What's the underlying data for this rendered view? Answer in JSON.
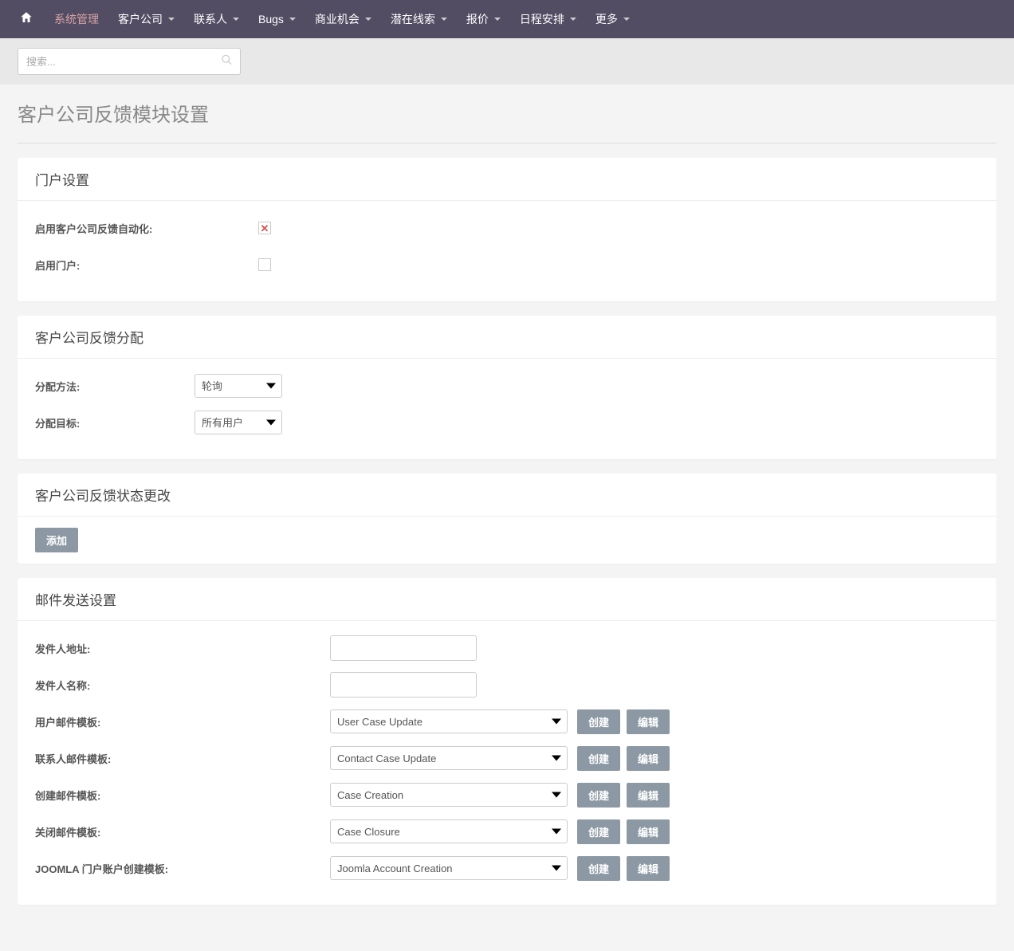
{
  "nav": {
    "items": [
      {
        "label": "系统管理",
        "active": true,
        "hasDropdown": false
      },
      {
        "label": "客户公司",
        "active": false,
        "hasDropdown": true
      },
      {
        "label": "联系人",
        "active": false,
        "hasDropdown": true
      },
      {
        "label": "Bugs",
        "active": false,
        "hasDropdown": true
      },
      {
        "label": "商业机会",
        "active": false,
        "hasDropdown": true
      },
      {
        "label": "潜在线索",
        "active": false,
        "hasDropdown": true
      },
      {
        "label": "报价",
        "active": false,
        "hasDropdown": true
      },
      {
        "label": "日程安排",
        "active": false,
        "hasDropdown": true
      },
      {
        "label": "更多",
        "active": false,
        "hasDropdown": true
      }
    ]
  },
  "search": {
    "placeholder": "搜索..."
  },
  "page": {
    "title": "客户公司反馈模块设置"
  },
  "sections": {
    "portal": {
      "title": "门户设置",
      "fields": {
        "enableAuto": {
          "label": "启用客户公司反馈自动化:",
          "checked": false,
          "x": true
        },
        "enablePortal": {
          "label": "启用门户:",
          "checked": false,
          "x": false
        }
      }
    },
    "assignment": {
      "title": "客户公司反馈分配",
      "fields": {
        "method": {
          "label": "分配方法:",
          "value": "轮询"
        },
        "target": {
          "label": "分配目标:",
          "value": "所有用户"
        }
      }
    },
    "stateChange": {
      "title": "客户公司反馈状态更改",
      "addButton": "添加"
    },
    "email": {
      "title": "邮件发送设置",
      "fields": {
        "fromAddr": {
          "label": "发件人地址:",
          "value": ""
        },
        "fromName": {
          "label": "发件人名称:",
          "value": ""
        }
      },
      "templates": [
        {
          "label": "用户邮件模板:",
          "value": "User Case Update"
        },
        {
          "label": "联系人邮件模板:",
          "value": "Contact Case Update"
        },
        {
          "label": "创建邮件模板:",
          "value": "Case Creation"
        },
        {
          "label": "关闭邮件模板:",
          "value": "Case Closure"
        },
        {
          "label": "JOOMLA 门户账户创建模板:",
          "value": "Joomla Account Creation"
        }
      ],
      "buttons": {
        "create": "创建",
        "edit": "编辑"
      }
    }
  }
}
